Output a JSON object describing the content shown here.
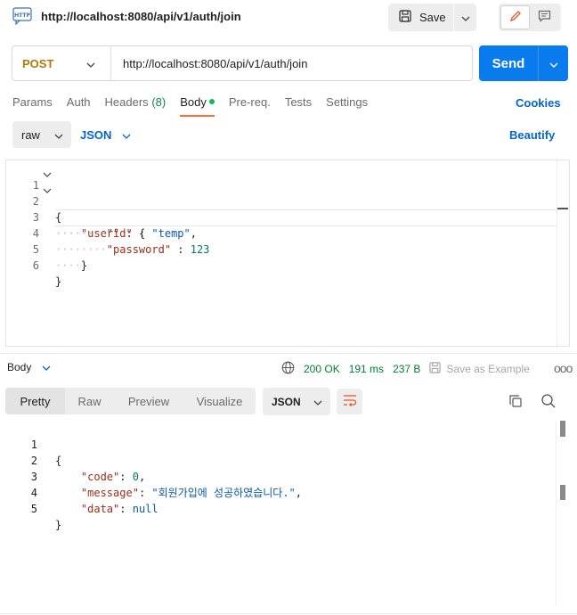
{
  "title_bar": {
    "http_icon_text": "HTTP",
    "request_name": "http://localhost:8080/api/v1/auth/join",
    "save_label": "Save",
    "icons": [
      "http-icon",
      "save-icon",
      "chevron-down-icon",
      "pencil-icon",
      "comment-icon"
    ]
  },
  "request": {
    "method": "POST",
    "url": "http://localhost:8080/api/v1/auth/join",
    "send_label": "Send",
    "method_color": "#ad7a03",
    "send_color": "#097bed"
  },
  "tabs": [
    {
      "label": "Params"
    },
    {
      "label": "Auth"
    },
    {
      "label": "Headers",
      "count": "(8)"
    },
    {
      "label": "Body",
      "active": true
    },
    {
      "label": "Pre-req."
    },
    {
      "label": "Tests"
    },
    {
      "label": "Settings"
    }
  ],
  "cookies_label": "Cookies",
  "body_toolbar": {
    "raw_label": "raw",
    "json_label": "JSON",
    "beautify_label": "Beautify"
  },
  "request_body": {
    "line_numbers": [
      "1",
      "2",
      "3",
      "4",
      "5",
      "6"
    ],
    "lines": {
      "l1": "{",
      "l2_key": "\"user\"",
      "l2_rest": " : {",
      "l3_key": "\"id\"",
      "l3_sep": " : ",
      "l3_val": "\"temp\"",
      "l3_end": ",",
      "l4_key": "\"password\"",
      "l4_sep": " : ",
      "l4_val": "123",
      "l5": "}",
      "l6": "}"
    }
  },
  "response_bar": {
    "body_label": "Body",
    "status": "200 OK",
    "time": "191 ms",
    "size": "237 B",
    "save_example_label": "Save as Example",
    "more_label": "ooo"
  },
  "response_views": {
    "tabs": [
      "Pretty",
      "Raw",
      "Preview",
      "Visualize"
    ],
    "active": "Pretty",
    "format_label": "JSON"
  },
  "response_body": {
    "line_numbers": [
      "1",
      "2",
      "3",
      "4",
      "5"
    ],
    "lines": {
      "l1": "{",
      "l2_key": "\"code\"",
      "l2_val": "0",
      "l3_key": "\"message\"",
      "l3_val": "\"회원가입에 성공하였습니다.\"",
      "l4_key": "\"data\"",
      "l4_val": "null",
      "l5": "}"
    }
  }
}
